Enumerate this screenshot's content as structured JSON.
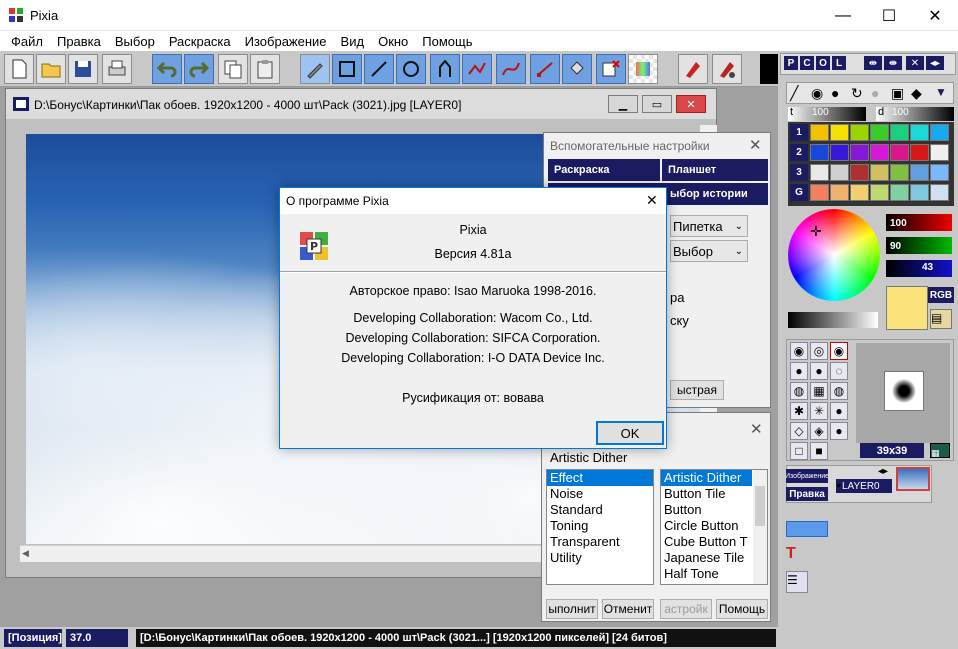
{
  "app": {
    "title": "Pixia",
    "min_glyph": "—",
    "max_glyph": "☐",
    "close_glyph": "✕"
  },
  "menu": [
    "Файл",
    "Правка",
    "Выбор",
    "Раскраска",
    "Изображение",
    "Вид",
    "Окно",
    "Помощь"
  ],
  "document": {
    "title": "D:\\Бонус\\Картинки\\Пак обоев. 1920x1200 - 4000 шт\\Pack  (3021).jpg [LAYER0]"
  },
  "helper": {
    "title": "Вспомогательные настройки",
    "tab_paint": "Раскраска",
    "tab_tablet": "Планшет",
    "tab_history": "ыбор истории",
    "select1": "Пипетка",
    "select2": "Выбор",
    "label1": "ра",
    "label2": "ску",
    "fast_button": "ыстрая"
  },
  "artistic": {
    "header": "Artistic Dither",
    "categories": [
      "Effect",
      "Noise",
      "Standard",
      "Toning",
      "Transparent",
      "Utility"
    ],
    "selected_category": 0,
    "effects": [
      "Artistic Dither",
      "Button Tile",
      "Button",
      "Circle Button",
      "Cube Button T",
      "Japanese Tile",
      "Half Tone"
    ],
    "selected_effect": 0,
    "buttons": [
      "ыполнит",
      "Отменит",
      "астройк",
      "Помощь"
    ]
  },
  "about": {
    "title": "О программе Pixia",
    "app_name": "Pixia",
    "version": "Версия 4.81a",
    "copyright": "Авторское право: Isao Maruoka 1998-2016.",
    "collab1": "Developing Collaboration: Wacom Co., Ltd.",
    "collab2": "Developing Collaboration: SIFCA Corporation.",
    "collab3": "Developing Collaboration: I-O DATA Device Inc.",
    "russification": "Русификация от: вовава",
    "ok": "OK"
  },
  "right_panel": {
    "tabs": [
      "P",
      "C",
      "O",
      "L"
    ],
    "t_label": "t",
    "t_value": "100",
    "d_label": "d",
    "d_value": "100",
    "rows": [
      "1",
      "2",
      "3",
      "G"
    ],
    "red_value": "100",
    "green_value": "90",
    "blue_value": "43",
    "rgb_label": "RGB",
    "brush_size": "39x39",
    "layer_label": "Изображение",
    "edit_label": "Правка",
    "layer_name": "LAYER0"
  },
  "status": {
    "position_label": "[Позиция]",
    "zoom": "37.0",
    "info": "[D:\\Бонус\\Картинки\\Пак обоев. 1920x1200 - 4000 шт\\Pack  (3021...] [1920x1200 пикселей] [24 битов]"
  },
  "colors": {
    "accent": "#0078d7",
    "navy": "#1b1b62",
    "panel": "#c8c8c8",
    "current_color": "#fbe37b"
  }
}
